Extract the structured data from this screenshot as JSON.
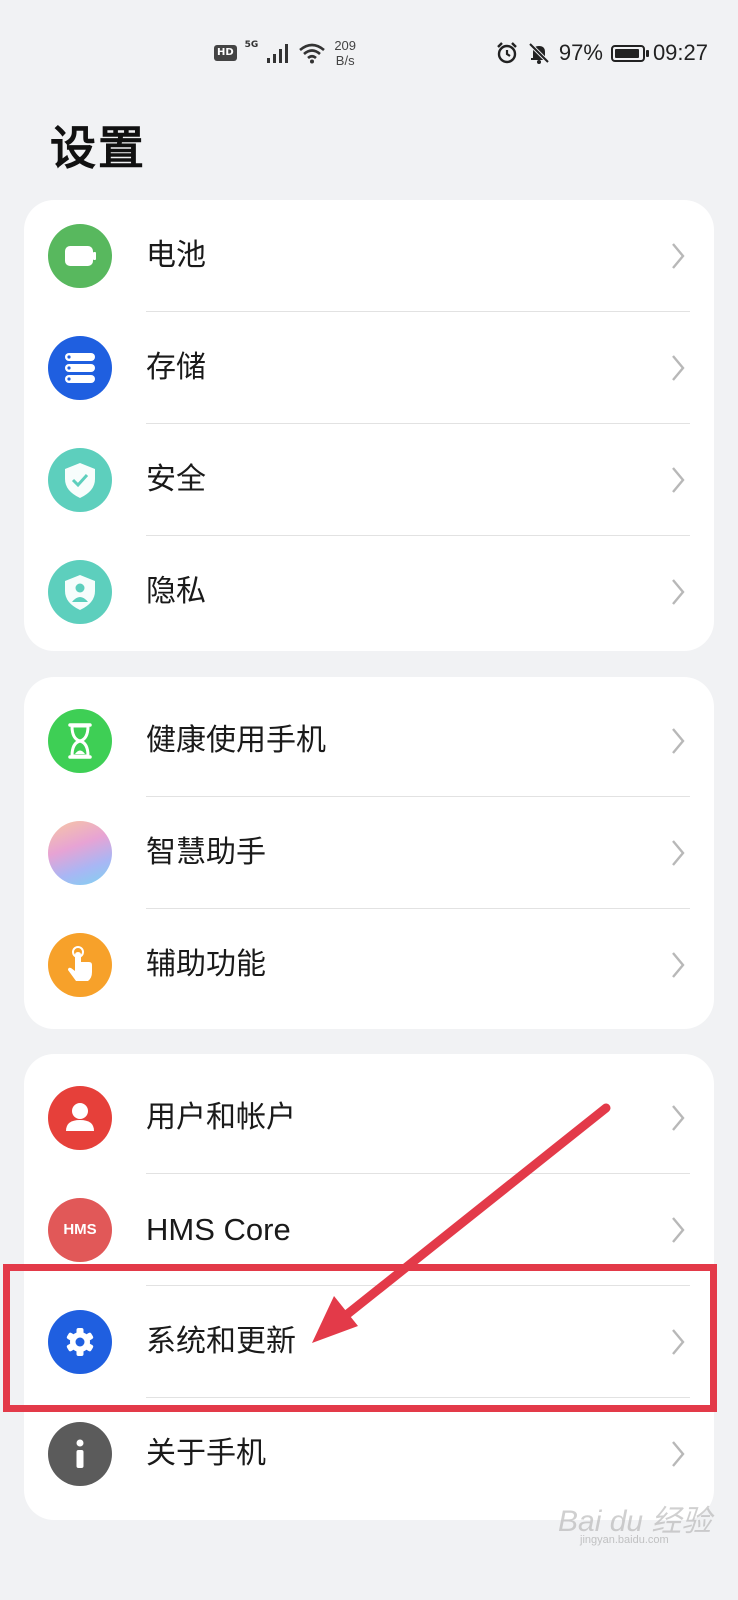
{
  "status_bar": {
    "hd": "HD",
    "network": "5G",
    "speed_value": "209",
    "speed_unit": "B/s",
    "battery": "97%",
    "battery_level": 0.97,
    "time": "09:27"
  },
  "page_title": "设置",
  "groups": [
    {
      "items": [
        {
          "label": "电池",
          "icon": "battery-icon",
          "color": "#58b85e"
        },
        {
          "label": "存储",
          "icon": "storage-icon",
          "color": "#1f5fe0"
        },
        {
          "label": "安全",
          "icon": "security-shield-icon",
          "color": "#5dcfbd"
        },
        {
          "label": "隐私",
          "icon": "privacy-shield-icon",
          "color": "#5dcfbd"
        }
      ]
    },
    {
      "items": [
        {
          "label": "健康使用手机",
          "icon": "hourglass-icon",
          "color": "#3ecf55"
        },
        {
          "label": "智慧助手",
          "icon": "smart-assistant-icon",
          "color": "#c9a4e8"
        },
        {
          "label": "辅助功能",
          "icon": "accessibility-hand-icon",
          "color": "#f7a12a"
        }
      ]
    },
    {
      "items": [
        {
          "label": "用户和帐户",
          "icon": "user-icon",
          "color": "#e6403a"
        },
        {
          "label": "HMS Core",
          "icon": "hms-core-icon",
          "icon_text": "HMS",
          "color": "#e15858"
        },
        {
          "label": "系统和更新",
          "icon": "gear-icon",
          "color": "#1f5fe0"
        },
        {
          "label": "关于手机",
          "icon": "info-icon",
          "color": "#5b5b5b"
        }
      ]
    }
  ],
  "watermark": "Bai du 经验",
  "watermark_sub": "jingyan.baidu.com",
  "annotation_color": "#e33a49"
}
